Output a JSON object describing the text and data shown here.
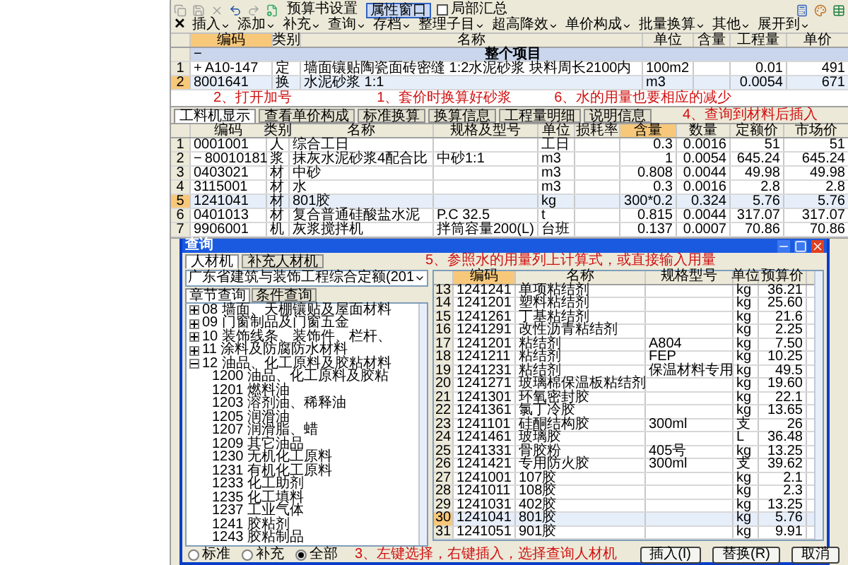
{
  "toolbar_top": {
    "buttons": [
      {
        "label": "预算书设置",
        "selected": false
      },
      {
        "label": "属性窗口",
        "selected": true
      }
    ],
    "checkbox": {
      "label": "局部汇总",
      "checked": false
    }
  },
  "toolbar_main": {
    "close": "✕",
    "menus": [
      "插入",
      "添加",
      "补充",
      "查询",
      "存档",
      "整理子目",
      "超高降效",
      "单价构成",
      "批量换算",
      "其他",
      "展开到"
    ]
  },
  "item_grid": {
    "columns": [
      {
        "label": "编码",
        "selected": true
      },
      {
        "label": "类别",
        "selected": false
      },
      {
        "label": "名称",
        "selected": false
      },
      {
        "label": "单位",
        "selected": false
      },
      {
        "label": "含量",
        "selected": false
      },
      {
        "label": "工程量",
        "selected": false
      },
      {
        "label": "单价",
        "selected": false
      }
    ],
    "group": {
      "expander": "−",
      "label": "整个项目"
    },
    "rows": [
      {
        "num": "1",
        "expander": "+",
        "selected": false,
        "cells": [
          "A10-147",
          "定",
          "墙面镶贴陶瓷面砖密缝 1:2水泥砂浆 块料周长2100内",
          "100m2",
          "",
          "0.01",
          "491"
        ]
      },
      {
        "num": "2",
        "selected": true,
        "cells": [
          "8001641",
          "换",
          "水泥砂浆 1:1",
          "m3",
          "",
          "0.0054",
          "671"
        ]
      }
    ],
    "notes": [
      "2、打开加号",
      "1、套价时换算好砂浆",
      "6、水的用量也要相应的减少"
    ]
  },
  "detail_tabs": [
    {
      "label": "工料机显示",
      "selected": true
    },
    {
      "label": "查看单价构成",
      "selected": false
    },
    {
      "label": "标准换算",
      "selected": false
    },
    {
      "label": "换算信息",
      "selected": false
    },
    {
      "label": "工程量明细",
      "selected": false
    },
    {
      "label": "说明信息",
      "selected": false
    }
  ],
  "resource_grid": {
    "columns": [
      {
        "label": "编码",
        "selected": false
      },
      {
        "label": "类别",
        "selected": false
      },
      {
        "label": "名称",
        "selected": false
      },
      {
        "label": "规格及型号",
        "selected": false
      },
      {
        "label": "单位",
        "selected": false
      },
      {
        "label": "损耗率",
        "selected": false
      },
      {
        "label": "含量",
        "selected": true
      },
      {
        "label": "数量",
        "selected": false
      },
      {
        "label": "定额价",
        "selected": false
      },
      {
        "label": "市场价",
        "selected": false
      }
    ],
    "rows": [
      {
        "num": "1",
        "selected": false,
        "cells": [
          "0001001",
          "人",
          "综合工日",
          "",
          "工日",
          "",
          "0.3",
          "0.0016",
          "51",
          "51"
        ]
      },
      {
        "num": "2",
        "expander": "−",
        "selected": false,
        "cells": [
          "80010181",
          "浆",
          "抹灰水泥砂浆4配合比",
          "中砂1:1",
          "m3",
          "",
          "1",
          "0.0054",
          "645.24",
          "645.24"
        ]
      },
      {
        "num": "3",
        "selected": false,
        "cells": [
          "0403021",
          "材",
          "中砂",
          "",
          "m3",
          "",
          "0.808",
          "0.0044",
          "49.98",
          "49.98"
        ]
      },
      {
        "num": "4",
        "selected": false,
        "cells": [
          "3115001",
          "材",
          "水",
          "",
          "m3",
          "",
          "0.3",
          "0.0016",
          "2.8",
          "2.8"
        ]
      },
      {
        "num": "5",
        "selected": true,
        "cells": [
          "1241041",
          "材",
          "801胶",
          "",
          "kg",
          "",
          "300*0.2",
          "0.324",
          "5.76",
          "5.76"
        ]
      },
      {
        "num": "6",
        "selected": false,
        "cells": [
          "0401013",
          "材",
          "复合普通硅酸盐水泥",
          "P.C 32.5",
          "t",
          "",
          "0.815",
          "0.0044",
          "317.07",
          "317.07"
        ]
      },
      {
        "num": "7",
        "selected": false,
        "cells": [
          "9906001",
          "机",
          "灰浆搅拌机",
          "拌筒容量200(L)",
          "台班",
          "",
          "0.137",
          "0.0007",
          "70.86",
          "70.86"
        ]
      }
    ],
    "note": "4、查询到材料后插入"
  },
  "dialog": {
    "title": "查询",
    "tabs": [
      {
        "label": "人材机",
        "selected": true
      },
      {
        "label": "补充人材机",
        "selected": false
      }
    ],
    "library": "广东省建筑与装饰工程综合定额(201",
    "search_tabs": [
      {
        "label": "章节查询",
        "selected": true
      },
      {
        "label": "条件查询",
        "selected": false
      }
    ],
    "tree": [
      {
        "label": "08 墙面、天棚镶贴及屋面材料",
        "expanded": false
      },
      {
        "label": "09 门窗制品及门窗五金",
        "expanded": false
      },
      {
        "label": "10 装饰线条、装饰件、栏杆、",
        "expanded": false
      },
      {
        "label": "11 涂料及防腐防水材料",
        "expanded": false
      },
      {
        "label": "12 油品、化工原料及胶粘材料",
        "expanded": true,
        "children": [
          {
            "label": "1200 油品、化工原料及胶粘"
          },
          {
            "label": "1201 燃料油"
          },
          {
            "label": "1203 溶剂油、稀释油"
          },
          {
            "label": "1205 润滑油"
          },
          {
            "label": "1207 润滑脂、蜡"
          },
          {
            "label": "1209 其它油品"
          },
          {
            "label": "1230 无机化工原料"
          },
          {
            "label": "1231 有机化工原料"
          },
          {
            "label": "1233 化工助剂"
          },
          {
            "label": "1235 化工填料"
          },
          {
            "label": "1237 工业气体"
          },
          {
            "label": "1241 胶粘剂"
          },
          {
            "label": "1243 胶粘制品"
          }
        ]
      }
    ],
    "radios": [
      {
        "label": "标准",
        "selected": false
      },
      {
        "label": "补充",
        "selected": false
      },
      {
        "label": "全部",
        "selected": true
      }
    ],
    "columns": [
      {
        "label": "编码",
        "selected": true
      },
      {
        "label": "名称",
        "selected": false
      },
      {
        "label": "规格型号",
        "selected": false
      },
      {
        "label": "单位",
        "selected": false
      },
      {
        "label": "预算价",
        "selected": false
      }
    ],
    "rows": [
      {
        "num": "13",
        "selected": false,
        "cells": [
          "1241241",
          "单项粘结剂",
          "",
          "kg",
          "36.21"
        ]
      },
      {
        "num": "14",
        "selected": false,
        "cells": [
          "1241201",
          "塑料粘结剂",
          "",
          "kg",
          "25.60"
        ]
      },
      {
        "num": "15",
        "selected": false,
        "cells": [
          "1241261",
          "丁基粘结剂",
          "",
          "kg",
          "21.6"
        ]
      },
      {
        "num": "16",
        "selected": false,
        "cells": [
          "1241291",
          "改性沥青粘结剂",
          "",
          "kg",
          "2.25"
        ]
      },
      {
        "num": "17",
        "selected": false,
        "cells": [
          "1241201",
          "粘结剂",
          "A804",
          "kg",
          "7.50"
        ]
      },
      {
        "num": "18",
        "selected": false,
        "cells": [
          "1241211",
          "粘结剂",
          "FEP",
          "kg",
          "10.25"
        ]
      },
      {
        "num": "19",
        "selected": false,
        "cells": [
          "1241231",
          "粘结剂",
          "保温材料专用",
          "kg",
          "49.5"
        ]
      },
      {
        "num": "20",
        "selected": false,
        "cells": [
          "1241271",
          "玻璃棉保温板粘结剂",
          "",
          "kg",
          "19.60"
        ]
      },
      {
        "num": "21",
        "selected": false,
        "cells": [
          "1241301",
          "环氧密封胶",
          "",
          "kg",
          "22.1"
        ]
      },
      {
        "num": "22",
        "selected": false,
        "cells": [
          "1241361",
          "氯丁冷胶",
          "",
          "kg",
          "13.65"
        ]
      },
      {
        "num": "23",
        "selected": false,
        "cells": [
          "1241101",
          "硅酮结构胶",
          "300ml",
          "支",
          "26"
        ]
      },
      {
        "num": "24",
        "selected": false,
        "cells": [
          "1241461",
          "玻璃胶",
          "",
          "L",
          "36.48"
        ]
      },
      {
        "num": "25",
        "selected": false,
        "cells": [
          "1241331",
          "骨胶粉",
          "405号",
          "kg",
          "13.25"
        ]
      },
      {
        "num": "26",
        "selected": false,
        "cells": [
          "1241421",
          "专用防火胶",
          "300ml",
          "支",
          "39.62"
        ]
      },
      {
        "num": "27",
        "selected": false,
        "cells": [
          "1241001",
          "107胶",
          "",
          "kg",
          "2.1"
        ]
      },
      {
        "num": "28",
        "selected": false,
        "cells": [
          "1241011",
          "108胶",
          "",
          "kg",
          "2.3"
        ]
      },
      {
        "num": "29",
        "selected": false,
        "cells": [
          "1241031",
          "402胶",
          "",
          "kg",
          "13.25"
        ]
      },
      {
        "num": "30",
        "selected": true,
        "cells": [
          "1241041",
          "801胶",
          "",
          "kg",
          "5.76"
        ]
      },
      {
        "num": "31",
        "selected": false,
        "cells": [
          "1241051",
          "901胶",
          "",
          "kg",
          "9.91"
        ]
      }
    ],
    "buttons": [
      "插入(I)",
      "替换(R)",
      "取消"
    ],
    "notes": [
      "5、参照水的用量列上计算式，或直接输入用量",
      "3、左键选择，右键插入，选择查询人材机"
    ]
  }
}
